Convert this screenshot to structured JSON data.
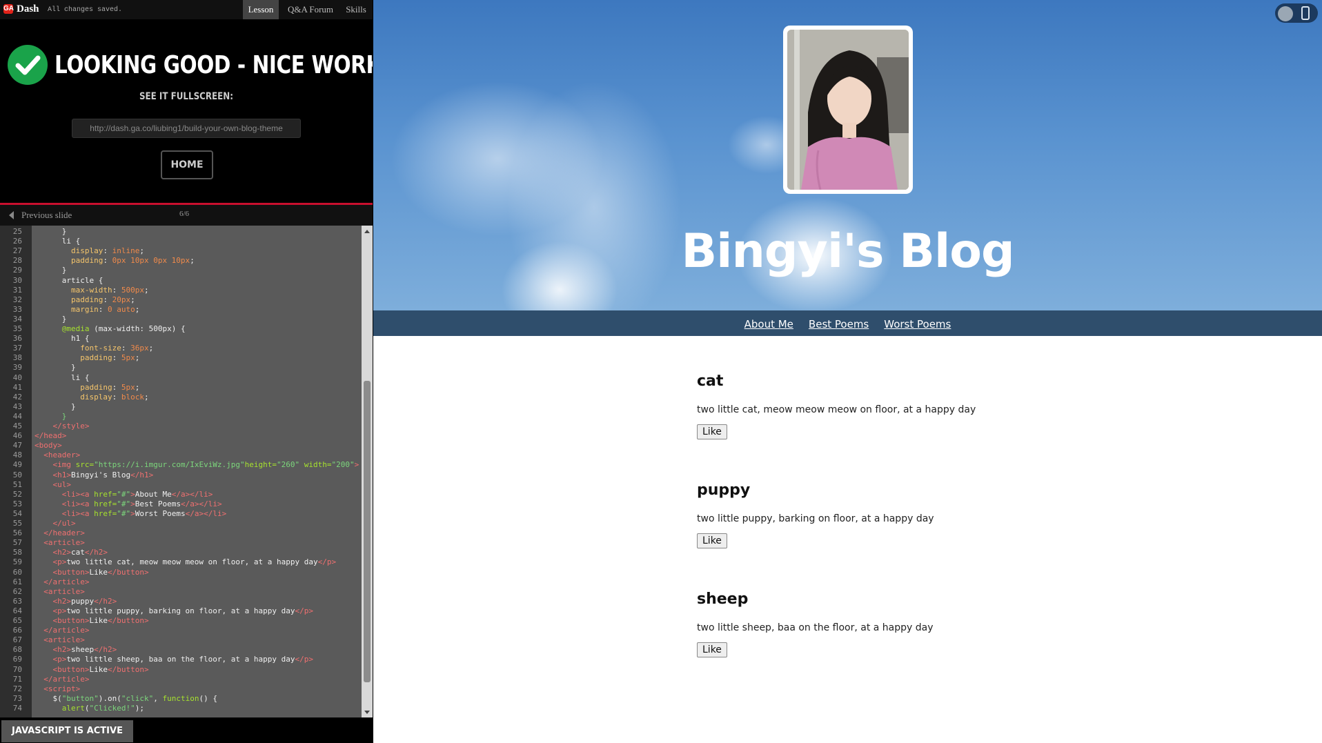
{
  "topbar": {
    "logo": "GA",
    "brand": "Dash",
    "status": "All changes saved.",
    "tabs": [
      {
        "label": "Lesson",
        "active": true
      },
      {
        "label": "Q&A Forum",
        "active": false
      },
      {
        "label": "Skills",
        "active": false
      }
    ]
  },
  "success": {
    "headline": "LOOKING GOOD - NICE WORK!",
    "see_it": "SEE IT FULLSCREEN:",
    "url": "http://dash.ga.co/liubing1/build-your-own-blog-theme",
    "home_label": "HOME"
  },
  "slidebar": {
    "prev_label": "Previous slide",
    "counter": "6/6"
  },
  "editor": {
    "lines": [
      {
        "n": "25",
        "html": "      }"
      },
      {
        "n": "26",
        "html": "      li {"
      },
      {
        "n": "27",
        "html": "        <span class=\"k\">display</span>: <span class=\"v\">inline</span>;"
      },
      {
        "n": "28",
        "html": "        <span class=\"k\">padding</span>: <span class=\"v\">0px 10px 0px 10px</span>;"
      },
      {
        "n": "29",
        "html": "      }"
      },
      {
        "n": "30",
        "html": "      article {"
      },
      {
        "n": "31",
        "html": "        <span class=\"k\">max-width</span>: <span class=\"v\">500px</span>;"
      },
      {
        "n": "32",
        "html": "        <span class=\"k\">padding</span>: <span class=\"v\">20px</span>;"
      },
      {
        "n": "33",
        "html": "        <span class=\"k\">margin</span>: <span class=\"v\">0 auto</span>;"
      },
      {
        "n": "34",
        "html": "      }"
      },
      {
        "n": "35",
        "html": "      <span class=\"at\">@media</span> (max-width: 500px) {"
      },
      {
        "n": "36",
        "html": "        h1 {"
      },
      {
        "n": "37",
        "html": "          <span class=\"k\">font-size</span>: <span class=\"v\">36px</span>;"
      },
      {
        "n": "38",
        "html": "          <span class=\"k\">padding</span>: <span class=\"v\">5px</span>;"
      },
      {
        "n": "39",
        "html": "        }"
      },
      {
        "n": "40",
        "html": "        li {"
      },
      {
        "n": "41",
        "html": "          <span class=\"k\">padding</span>: <span class=\"v\">5px</span>;"
      },
      {
        "n": "42",
        "html": "          <span class=\"k\">display</span>: <span class=\"v\">block</span>;"
      },
      {
        "n": "43",
        "html": "        }"
      },
      {
        "n": "44",
        "html": "      <span class=\"st\">}</span>"
      },
      {
        "n": "45",
        "html": "    <span class=\"tg\">&lt;/style&gt;</span>"
      },
      {
        "n": "46",
        "html": "<span class=\"tg\">&lt;/head&gt;</span>"
      },
      {
        "n": "47",
        "html": "<span class=\"tg\">&lt;body&gt;</span>"
      },
      {
        "n": "48",
        "html": "  <span class=\"tg\">&lt;header&gt;</span>"
      },
      {
        "n": "49",
        "html": "    <span class=\"tg\">&lt;img</span> <span class=\"at\">src=</span><span class=\"st\">\"https://i.imgur.com/IxEviWz.jpg\"</span><span class=\"at\">height=</span><span class=\"st\">\"260\"</span> <span class=\"at\">width=</span><span class=\"st\">\"200\"</span><span class=\"tg\">&gt;</span>"
      },
      {
        "n": "50",
        "html": "    <span class=\"tg\">&lt;h1&gt;</span>Bingyi's Blog<span class=\"tg\">&lt;/h1&gt;</span>"
      },
      {
        "n": "51",
        "html": "    <span class=\"tg\">&lt;ul&gt;</span>"
      },
      {
        "n": "52",
        "html": "      <span class=\"tg\">&lt;li&gt;&lt;a</span> <span class=\"at\">href=</span><span class=\"st\">\"#\"</span><span class=\"tg\">&gt;</span>About Me<span class=\"tg\">&lt;/a&gt;&lt;/li&gt;</span>"
      },
      {
        "n": "53",
        "html": "      <span class=\"tg\">&lt;li&gt;&lt;a</span> <span class=\"at\">href=</span><span class=\"st\">\"#\"</span><span class=\"tg\">&gt;</span>Best Poems<span class=\"tg\">&lt;/a&gt;&lt;/li&gt;</span>"
      },
      {
        "n": "54",
        "html": "      <span class=\"tg\">&lt;li&gt;&lt;a</span> <span class=\"at\">href=</span><span class=\"st\">\"#\"</span><span class=\"tg\">&gt;</span>Worst Poems<span class=\"tg\">&lt;/a&gt;&lt;/li&gt;</span>"
      },
      {
        "n": "55",
        "html": "    <span class=\"tg\">&lt;/ul&gt;</span>"
      },
      {
        "n": "56",
        "html": "  <span class=\"tg\">&lt;/header&gt;</span>"
      },
      {
        "n": "57",
        "html": "  <span class=\"tg\">&lt;article&gt;</span>"
      },
      {
        "n": "58",
        "html": "    <span class=\"tg\">&lt;h2&gt;</span>cat<span class=\"tg\">&lt;/h2&gt;</span>"
      },
      {
        "n": "59",
        "html": "    <span class=\"tg\">&lt;p&gt;</span>two little cat, meow meow meow on floor, at a happy day<span class=\"tg\">&lt;/p&gt;</span>"
      },
      {
        "n": "60",
        "html": "    <span class=\"tg\">&lt;button&gt;</span>Like<span class=\"tg\">&lt;/button&gt;</span>"
      },
      {
        "n": "61",
        "html": "  <span class=\"tg\">&lt;/article&gt;</span>"
      },
      {
        "n": "62",
        "html": "  <span class=\"tg\">&lt;article&gt;</span>"
      },
      {
        "n": "63",
        "html": "    <span class=\"tg\">&lt;h2&gt;</span>puppy<span class=\"tg\">&lt;/h2&gt;</span>"
      },
      {
        "n": "64",
        "html": "    <span class=\"tg\">&lt;p&gt;</span>two little puppy, barking on floor, at a happy day<span class=\"tg\">&lt;/p&gt;</span>"
      },
      {
        "n": "65",
        "html": "    <span class=\"tg\">&lt;button&gt;</span>Like<span class=\"tg\">&lt;/button&gt;</span>"
      },
      {
        "n": "66",
        "html": "  <span class=\"tg\">&lt;/article&gt;</span>"
      },
      {
        "n": "67",
        "html": "  <span class=\"tg\">&lt;article&gt;</span>"
      },
      {
        "n": "68",
        "html": "    <span class=\"tg\">&lt;h2&gt;</span>sheep<span class=\"tg\">&lt;/h2&gt;</span>"
      },
      {
        "n": "69",
        "html": "    <span class=\"tg\">&lt;p&gt;</span>two little sheep, baa on the floor, at a happy day<span class=\"tg\">&lt;/p&gt;</span>"
      },
      {
        "n": "70",
        "html": "    <span class=\"tg\">&lt;button&gt;</span>Like<span class=\"tg\">&lt;/button&gt;</span>"
      },
      {
        "n": "71",
        "html": "  <span class=\"tg\">&lt;/article&gt;</span>"
      },
      {
        "n": "72",
        "html": "  <span class=\"tg\">&lt;script&gt;</span>"
      },
      {
        "n": "73",
        "html": "    $(<span class=\"st\">\"button\"</span>).on(<span class=\"st\">\"click\"</span>, <span class=\"at\">function</span>() {"
      },
      {
        "n": "74",
        "html": "      <span class=\"at\">alert</span>(<span class=\"st\">\"Clicked!\"</span>);"
      }
    ]
  },
  "js_status": "JAVASCRIPT IS ACTIVE",
  "blog": {
    "title": "Bingyi's Blog",
    "nav": [
      "About Me",
      "Best Poems",
      "Worst Poems"
    ],
    "articles": [
      {
        "title": "cat",
        "body": "two little cat, meow meow meow on floor, at a happy day",
        "button": "Like"
      },
      {
        "title": "puppy",
        "body": "two little puppy, barking on floor, at a happy day",
        "button": "Like"
      },
      {
        "title": "sheep",
        "body": "two little sheep, baa on the floor, at a happy day",
        "button": "Like"
      }
    ]
  },
  "colors": {
    "accent_red": "#c8102e",
    "success_green": "#1aa34a",
    "nav_bar": "#2f4e6c"
  }
}
